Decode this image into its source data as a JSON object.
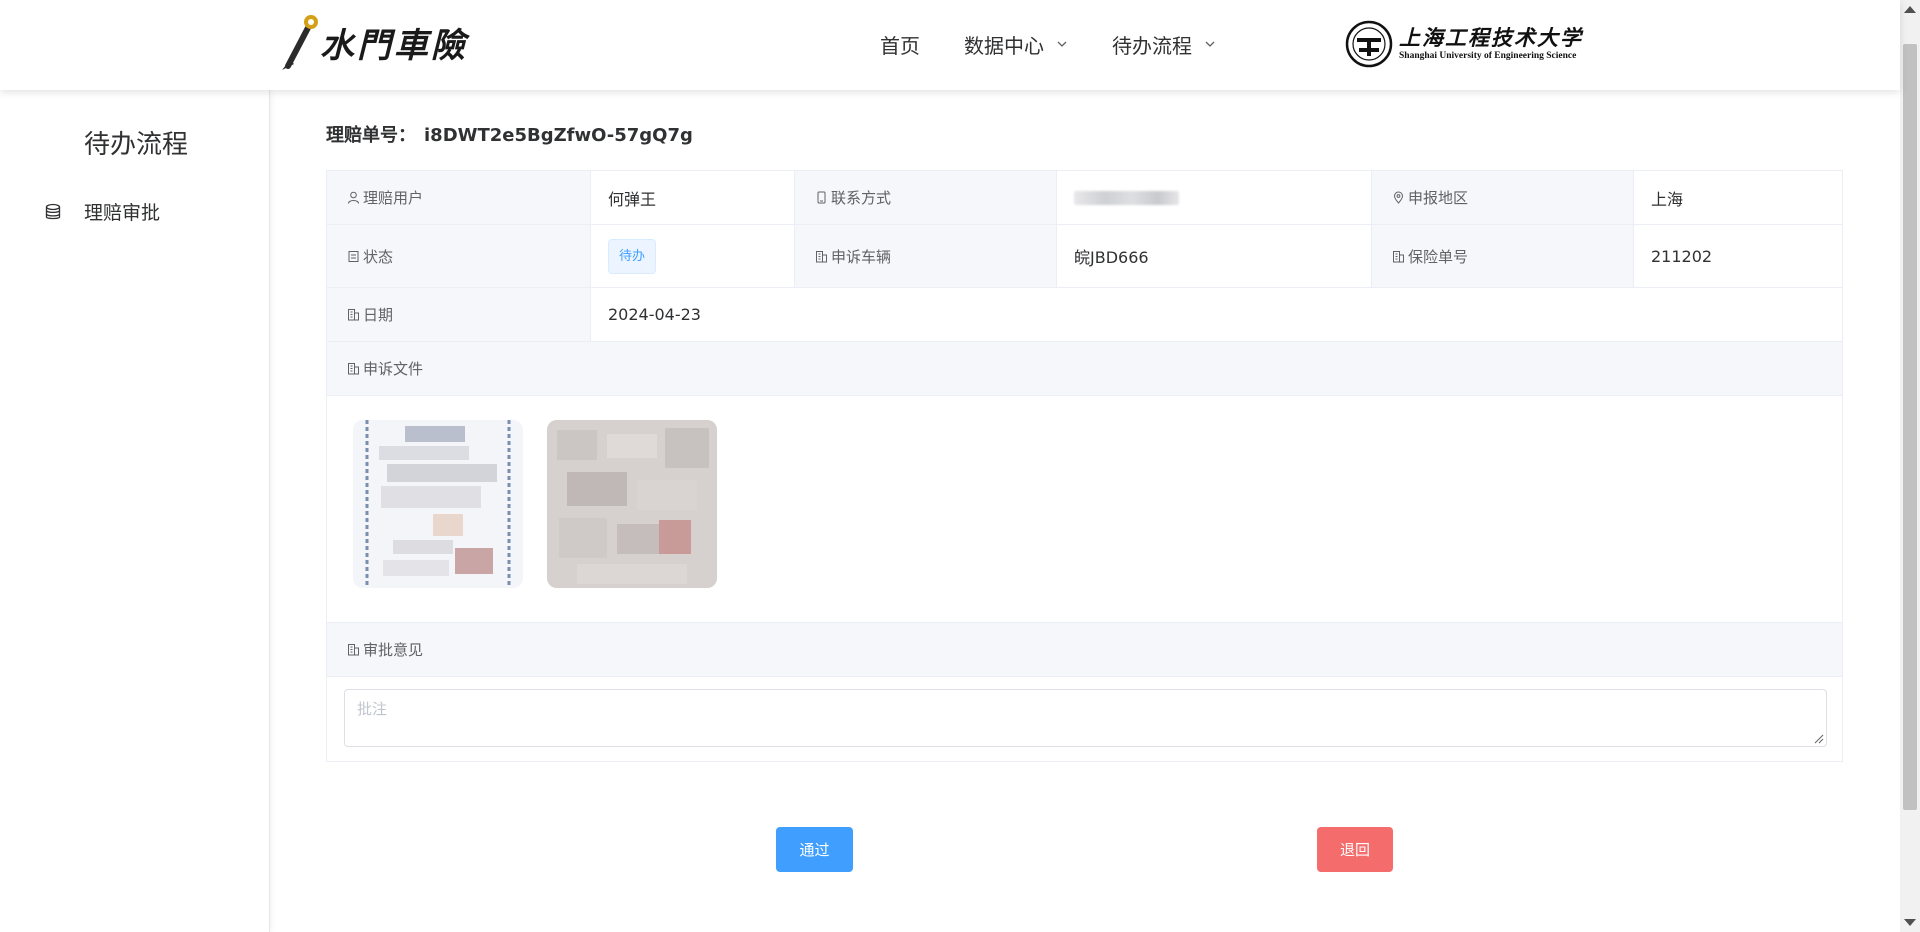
{
  "brand": {
    "logo_text": "水門車險"
  },
  "nav": {
    "items": [
      {
        "label": "首页"
      },
      {
        "label": "数据中心"
      },
      {
        "label": "待办流程"
      }
    ]
  },
  "university": {
    "name_cn": "上海工程技术大学",
    "name_en": "Shanghai University of Engineering Science"
  },
  "sidebar": {
    "title": "待办流程",
    "items": [
      {
        "label": "理赔审批",
        "icon": "database-icon"
      }
    ]
  },
  "claim": {
    "number_label": "理赔单号：",
    "number": "i8DWT2e5BgZfwO-57gQ7g"
  },
  "details": {
    "user_label": "理赔用户",
    "user": "何弹王",
    "contact_label": "联系方式",
    "region_label": "申报地区",
    "region": "上海",
    "status_label": "状态",
    "status": "待办",
    "vehicle_label": "申诉车辆",
    "vehicle": "皖JBD666",
    "policy_label": "保险单号",
    "policy": "211202",
    "date_label": "日期",
    "date": "2024-04-23",
    "files_label": "申诉文件",
    "opinion_label": "审批意见"
  },
  "opinion": {
    "placeholder": "批注"
  },
  "actions": {
    "pass_label": "通过",
    "back_label": "退回"
  },
  "colors": {
    "primary": "#409eff",
    "danger": "#f56c6c",
    "label_bg": "#f5f7fa",
    "border": "#ebeef5"
  }
}
